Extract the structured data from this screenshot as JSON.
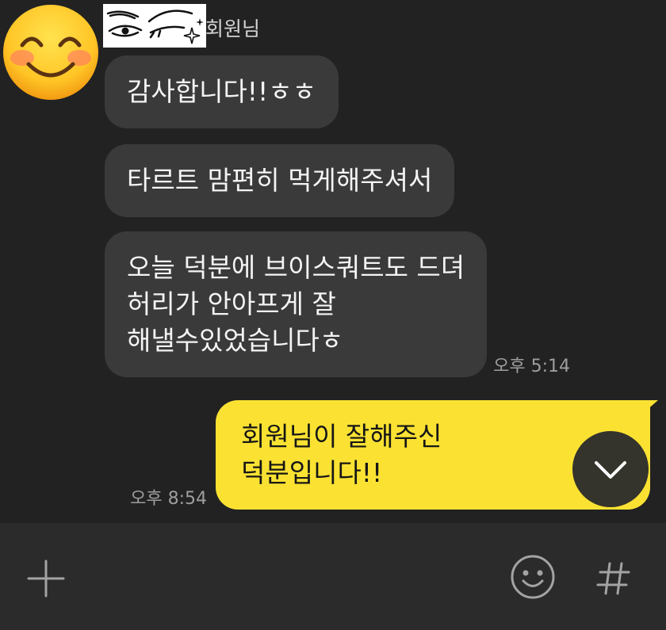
{
  "theme": {
    "chat_background": "#222222",
    "received_bubble": "#3a3a3a",
    "sent_bubble": "#fbe232",
    "input_bar_background": "#2b2b2b",
    "timestamp_color": "#9e9e9e"
  },
  "sender": {
    "name": "회원님",
    "avatar_icon": "smiling-face-with-smiling-eyes-icon",
    "name_cover_icon": "eyes-doodle-icon"
  },
  "messages": {
    "received": [
      {
        "lines": [
          "감사합니다!!ㅎㅎ"
        ]
      },
      {
        "lines": [
          "타르트 맘편히 먹게해주셔서"
        ]
      },
      {
        "lines": [
          "오늘 덕분에 브이스쿼트도 드뎌",
          "허리가 안아프게 잘",
          "해낼수있었습니다ㅎ"
        ],
        "time": "오후 5:14"
      }
    ],
    "sent": [
      {
        "lines": [
          "회원님이 잘해주신",
          "덕분입니다!!"
        ],
        "time": "오후 8:54"
      }
    ]
  },
  "scroll_button": {
    "icon": "chevron-down-icon"
  },
  "input_bar": {
    "attach_icon": "plus-icon",
    "emoticon_icon": "smiley-icon",
    "hashtag_icon": "hash-icon"
  }
}
